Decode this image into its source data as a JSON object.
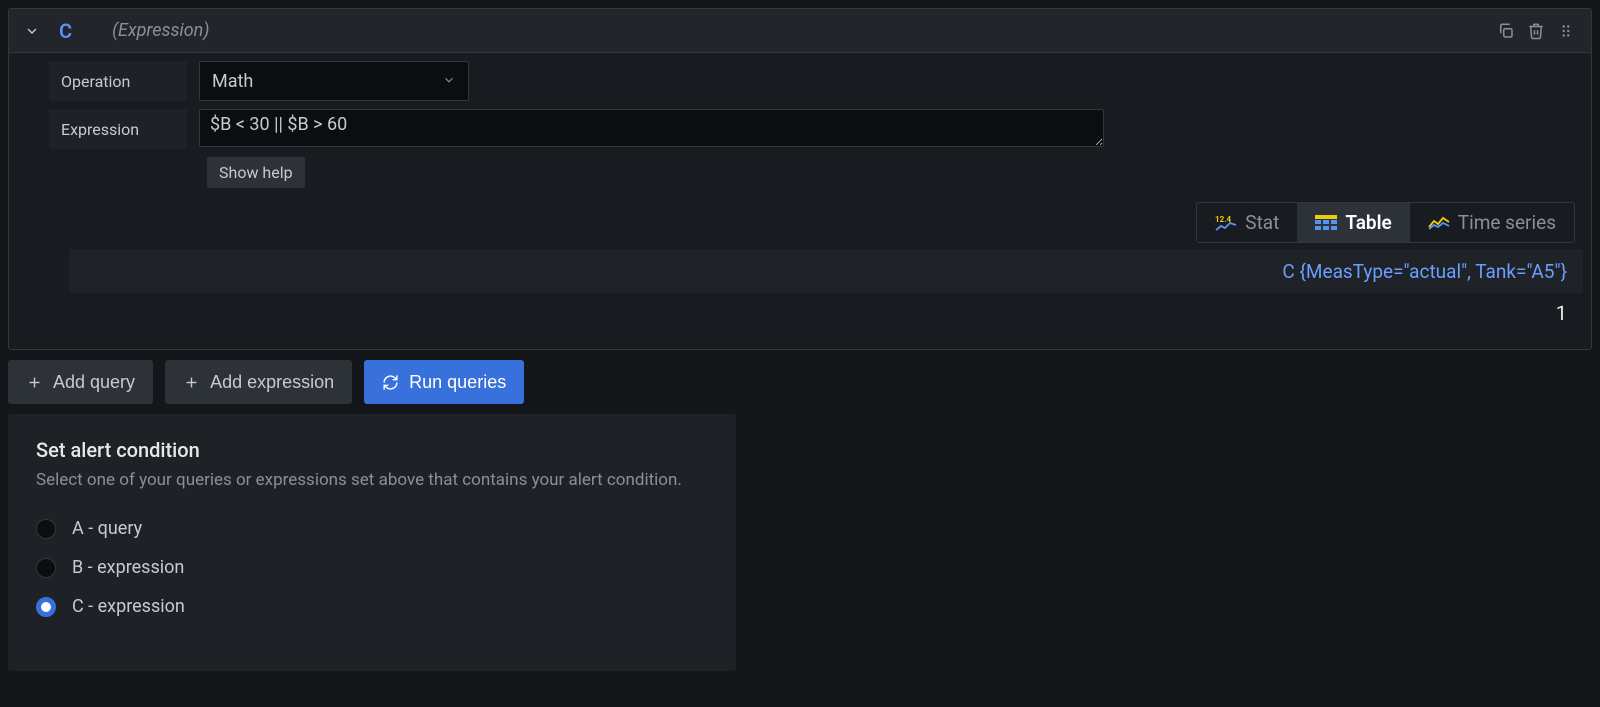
{
  "query": {
    "ref": "C",
    "tag": "(Expression)",
    "operation_label": "Operation",
    "operation_value": "Math",
    "expression_label": "Expression",
    "expression_value": "$B < 30 || $B > 60",
    "show_help": "Show help"
  },
  "viz": {
    "stat": "Stat",
    "table": "Table",
    "timeseries": "Time series"
  },
  "result": {
    "header": "C {MeasType=\"actual\", Tank=\"A5\"}",
    "value": "1"
  },
  "actions": {
    "add_query": "Add query",
    "add_expression": "Add expression",
    "run_queries": "Run queries"
  },
  "condition": {
    "title": "Set alert condition",
    "subtitle": "Select one of your queries or expressions set above that contains your alert condition.",
    "options": [
      {
        "label": "A - query",
        "selected": false
      },
      {
        "label": "B - expression",
        "selected": false
      },
      {
        "label": "C - expression",
        "selected": true
      }
    ]
  }
}
